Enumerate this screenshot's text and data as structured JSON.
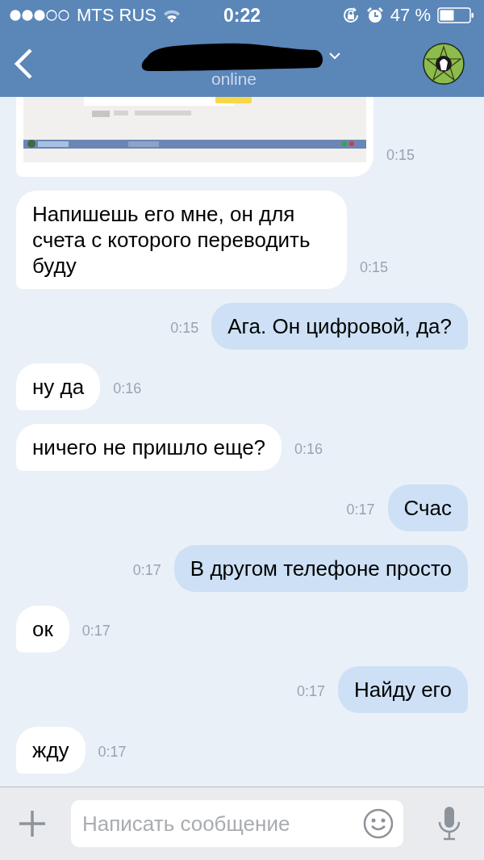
{
  "status_bar": {
    "carrier": "MTS RUS",
    "time": "0:22",
    "battery": "47 %"
  },
  "header": {
    "status": "online"
  },
  "messages": [
    {
      "sent": false,
      "time": "0:15"
    },
    {
      "kind": "text",
      "sent": false,
      "text": "Напишешь его мне, он для счета с которого переводить буду",
      "time": "0:15"
    },
    {
      "kind": "text",
      "sent": true,
      "text": "Ага. Он цифровой, да?",
      "time": "0:15"
    },
    {
      "kind": "text",
      "sent": false,
      "text": "ну да",
      "time": "0:16"
    },
    {
      "kind": "text",
      "sent": false,
      "text": "ничего не пришло еще?",
      "time": "0:16"
    },
    {
      "kind": "text",
      "sent": true,
      "text": "Счас",
      "time": "0:17"
    },
    {
      "kind": "text",
      "sent": true,
      "text": "В другом телефоне просто",
      "time": "0:17"
    },
    {
      "kind": "text",
      "sent": false,
      "text": "ок",
      "time": "0:17"
    },
    {
      "kind": "text",
      "sent": true,
      "text": "Найду его",
      "time": "0:17"
    },
    {
      "kind": "text",
      "sent": false,
      "text": "жду",
      "time": "0:17"
    }
  ],
  "composer": {
    "placeholder": "Написать сообщение"
  }
}
